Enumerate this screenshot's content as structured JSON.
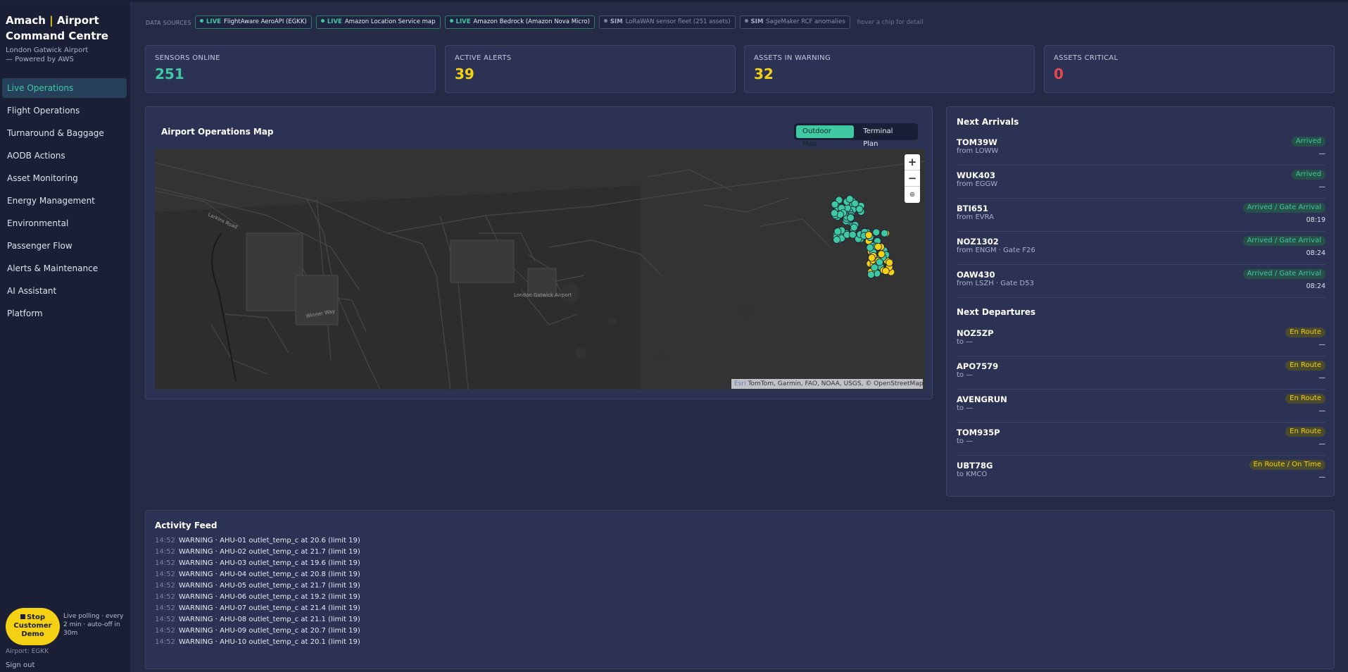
{
  "brand": {
    "name": "Amach",
    "name2": "Airport Command Centre",
    "subtitle": "London Gatwick Airport — Powered by AWS"
  },
  "nav": [
    {
      "label": "Live Operations",
      "active": true
    },
    {
      "label": "Flight Operations"
    },
    {
      "label": "Turnaround & Baggage"
    },
    {
      "label": "AODB Actions"
    },
    {
      "label": "Asset Monitoring"
    },
    {
      "label": "Energy Management"
    },
    {
      "label": "Environmental"
    },
    {
      "label": "Passenger Flow"
    },
    {
      "label": "Alerts & Maintenance"
    },
    {
      "label": "AI Assistant"
    },
    {
      "label": "Platform"
    }
  ],
  "sidebar_footer": {
    "demo_button": "Stop Customer Demo",
    "poll_note": "Live polling · every 2 min · auto-off in 30m",
    "airport": "Airport: EGKK",
    "signout": "Sign out"
  },
  "data_sources": {
    "label": "DATA SOURCES",
    "chips": [
      {
        "tag": "LIVE",
        "text": "FlightAware AeroAPI (EGKK)",
        "kind": "live"
      },
      {
        "tag": "LIVE",
        "text": "Amazon Location Service map",
        "kind": "live"
      },
      {
        "tag": "LIVE",
        "text": "Amazon Bedrock (Amazon Nova Micro)",
        "kind": "live"
      },
      {
        "tag": "SIM",
        "text": "LoRaWAN sensor fleet (251 assets)",
        "kind": "sim"
      },
      {
        "tag": "SIM",
        "text": "SageMaker RCF anomalies",
        "kind": "sim"
      }
    ],
    "hint": "hover a chip for detail"
  },
  "kpis": [
    {
      "label": "SENSORS ONLINE",
      "value": "251",
      "color": "#3ec9a2"
    },
    {
      "label": "ACTIVE ALERTS",
      "value": "39",
      "color": "#f5d114"
    },
    {
      "label": "ASSETS IN WARNING",
      "value": "32",
      "color": "#f5d114"
    },
    {
      "label": "ASSETS CRITICAL",
      "value": "0",
      "color": "#e5484d"
    }
  ],
  "map": {
    "title": "Airport Operations Map",
    "toggle": [
      "Outdoor Map",
      "Terminal Plan"
    ],
    "zoom_in": "+",
    "zoom_out": "−",
    "reset": "⊕",
    "labels": [
      "Larkins Road",
      "Winner Way",
      "London Gatwick Airport"
    ],
    "attribution_esri": "Esri",
    "attribution": "TomTom, Garmin, FAO, NOAA, USGS, © OpenStreetMap"
  },
  "flights": {
    "arrivals_title": "Next Arrivals",
    "departures_title": "Next Departures",
    "arrivals": [
      {
        "cs": "TOM39W",
        "from": "from LOWW",
        "status": "Arrived",
        "time": "—"
      },
      {
        "cs": "WUK403",
        "from": "from EGGW",
        "status": "Arrived",
        "time": "—"
      },
      {
        "cs": "BTI651",
        "from": "from EVRA",
        "status": "Arrived / Gate Arrival",
        "time": "08:19"
      },
      {
        "cs": "NOZ1302",
        "from": "from ENGM · Gate F26",
        "status": "Arrived / Gate Arrival",
        "time": "08:24"
      },
      {
        "cs": "OAW430",
        "from": "from LSZH · Gate D53",
        "status": "Arrived / Gate Arrival",
        "time": "08:24"
      }
    ],
    "departures": [
      {
        "cs": "NOZ5ZP",
        "from": "to —",
        "status": "En Route",
        "time": "—"
      },
      {
        "cs": "APO7579",
        "from": "to —",
        "status": "En Route",
        "time": "—"
      },
      {
        "cs": "AVENGRUN",
        "from": "to —",
        "status": "En Route",
        "time": "—"
      },
      {
        "cs": "TOM935P",
        "from": "to —",
        "status": "En Route",
        "time": "—"
      },
      {
        "cs": "UBT78G",
        "from": "to KMCO",
        "status": "En Route / On Time",
        "time": "—"
      }
    ]
  },
  "activity": {
    "title": "Activity Feed",
    "items": [
      {
        "t": "14:52",
        "m": "WARNING · AHU-01 outlet_temp_c at 20.6 (limit 19)"
      },
      {
        "t": "14:52",
        "m": "WARNING · AHU-02 outlet_temp_c at 21.7 (limit 19)"
      },
      {
        "t": "14:52",
        "m": "WARNING · AHU-03 outlet_temp_c at 19.6 (limit 19)"
      },
      {
        "t": "14:52",
        "m": "WARNING · AHU-04 outlet_temp_c at 20.8 (limit 19)"
      },
      {
        "t": "14:52",
        "m": "WARNING · AHU-05 outlet_temp_c at 21.7 (limit 19)"
      },
      {
        "t": "14:52",
        "m": "WARNING · AHU-06 outlet_temp_c at 19.2 (limit 19)"
      },
      {
        "t": "14:52",
        "m": "WARNING · AHU-07 outlet_temp_c at 21.4 (limit 19)"
      },
      {
        "t": "14:52",
        "m": "WARNING · AHU-08 outlet_temp_c at 21.1 (limit 19)"
      },
      {
        "t": "14:52",
        "m": "WARNING · AHU-09 outlet_temp_c at 20.7 (limit 19)"
      },
      {
        "t": "14:52",
        "m": "WARNING · AHU-10 outlet_temp_c at 20.1 (limit 19)"
      }
    ]
  }
}
